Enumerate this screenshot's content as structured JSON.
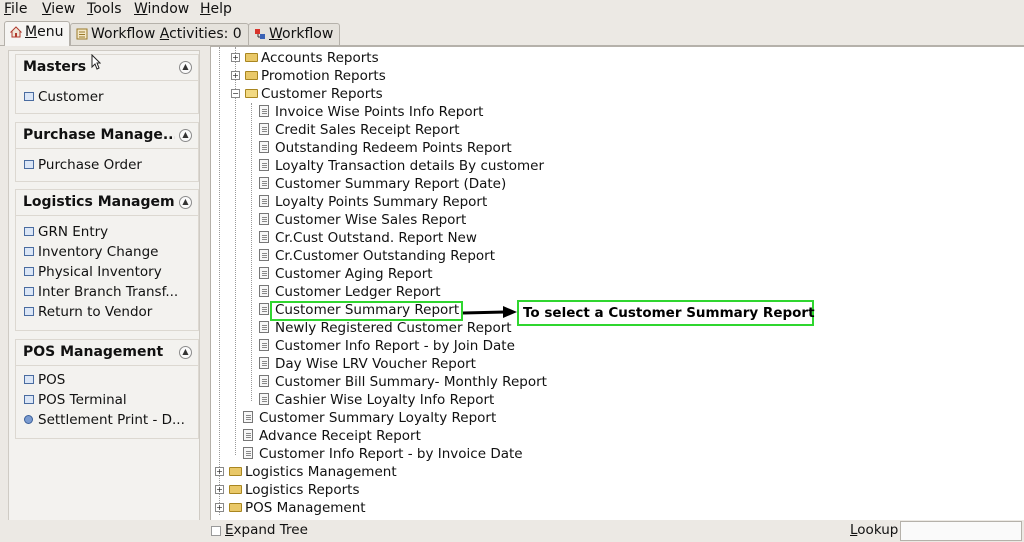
{
  "menubar": {
    "items": [
      {
        "first": "F",
        "rest": "ile"
      },
      {
        "first": "V",
        "rest": "iew"
      },
      {
        "first": "T",
        "rest": "ools"
      },
      {
        "first": "W",
        "rest": "indow"
      },
      {
        "first": "H",
        "rest": "elp"
      }
    ]
  },
  "tabs": [
    {
      "prefix": "",
      "under": "M",
      "rest": "enu",
      "icon": "home-icon"
    },
    {
      "prefix": "Workflow ",
      "under": "A",
      "rest": "ctivities: 0",
      "icon": "list-icon"
    },
    {
      "prefix": "",
      "under": "W",
      "rest": "orkflow",
      "icon": "workflow-icon"
    }
  ],
  "sidebar": {
    "groups": [
      {
        "title": "Masters",
        "items": [
          "Customer"
        ]
      },
      {
        "title": "Purchase Manage...",
        "items": [
          "Purchase Order"
        ]
      },
      {
        "title": "Logistics Managem...",
        "items": [
          "GRN Entry",
          "Inventory Change",
          "Physical Inventory",
          "Inter Branch Transf...",
          "Return to Vendor"
        ]
      },
      {
        "title": "POS Management",
        "items": [
          "POS",
          "POS Terminal",
          "Settlement Print - D..."
        ]
      }
    ]
  },
  "tree": {
    "accounts_reports": "Accounts Reports",
    "promotion_reports": "Promotion Reports",
    "customer_reports": "Customer Reports",
    "customer_children": [
      "Invoice Wise Points Info Report",
      "Credit Sales Receipt Report",
      "Outstanding Redeem Points Report",
      "Loyalty Transaction details By customer",
      "Customer Summary Report (Date)",
      "Loyalty Points Summary Report",
      "Customer Wise Sales Report",
      "Cr.Cust Outstand. Report New",
      "Cr.Customer Outstanding Report",
      "Customer Aging Report",
      "Customer Ledger Report",
      "Customer Summary Report",
      "Newly Registered Customer Report",
      "Customer Info Report - by Join Date",
      "Day Wise LRV Voucher Report",
      "Customer Bill Summary- Monthly Report",
      "Cashier Wise Loyalty Info Report"
    ],
    "sibling_reports": [
      "Customer Summary Loyalty Report",
      "Advance Receipt Report",
      "Customer Info Report - by Invoice Date"
    ],
    "top_folders": [
      "Logistics Management",
      "Logistics Reports",
      "POS Management"
    ]
  },
  "callout": {
    "text": "To select a Customer Summary Report"
  },
  "bottombar": {
    "expand_under": "E",
    "expand_rest": "xpand Tree",
    "lookup_under": "L",
    "lookup_rest": "ookup",
    "lookup_value": ""
  }
}
